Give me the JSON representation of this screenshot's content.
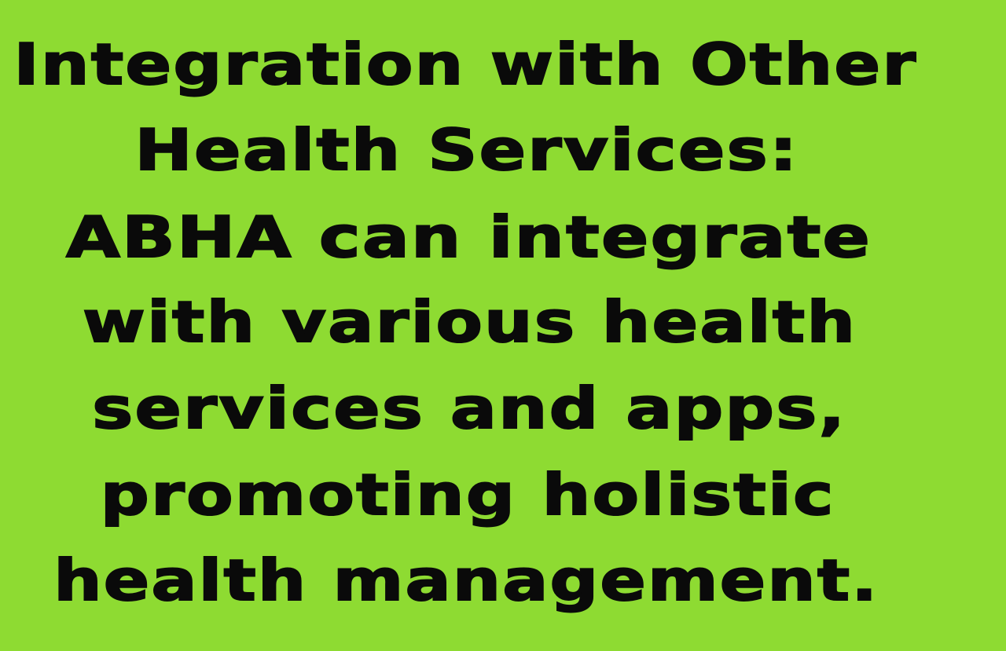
{
  "slide": {
    "background_color": "#8edb32",
    "text_color": "#0a0a0a",
    "lines": [
      "Integration with Other",
      "Health Services:",
      "ABHA can integrate",
      "with various health",
      "services and apps,",
      "promoting holistic",
      "health management."
    ]
  }
}
